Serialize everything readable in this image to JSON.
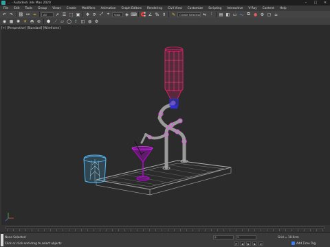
{
  "window": {
    "title": "... - Autodesk 3ds Max 2020",
    "minimize": "–",
    "maximize": "□",
    "close": "✕"
  },
  "menu": [
    "File",
    "Edit",
    "Tools",
    "Group",
    "Views",
    "Create",
    "Modifiers",
    "Animation",
    "Graph Editors",
    "Rendering",
    "Civil View",
    "Customize",
    "Scripting",
    "Interactive",
    "V-Ray",
    "Content",
    "Help"
  ],
  "toolbar": {
    "filter_dropdown": "All",
    "view_dropdown": "View",
    "selection_set_dropdown": "Create Selection Se"
  },
  "viewport": {
    "label": "[+] [Perspective] [Standard] [Wireframe]"
  },
  "icons": {
    "undo": "undo-icon",
    "redo": "redo-icon",
    "link": "link-icon",
    "unlink": "unlink-icon",
    "select": "select-arrow-icon",
    "move": "move-icon",
    "rotate": "rotate-icon",
    "scale": "scale-icon",
    "snap": "snap-icon",
    "mirror": "mirror-icon",
    "align": "align-icon",
    "render": "teapot-icon"
  },
  "colors": {
    "bottle": "#e0206a",
    "bottle_cap": "#3030d0",
    "pipes": "#9a9a9a",
    "joints": "#e060e0",
    "martini_glass": "#c000e0",
    "ice_bucket": "#50c0ff",
    "base_plate": "#b8b8b8"
  },
  "status": {
    "selection": "None Selected",
    "hint": "Click or click-and-drag to select objects",
    "grid": "Grid = 10.0cm",
    "add_time_tag": "Add Time Tag"
  }
}
